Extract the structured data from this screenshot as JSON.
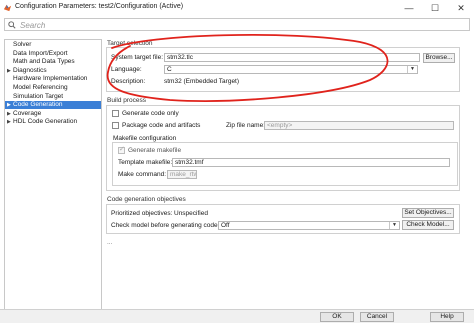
{
  "window": {
    "title": "Configuration Parameters: test2/Configuration (Active)",
    "minimize_label": "—",
    "maximize_label": "☐",
    "close_label": "✕"
  },
  "search": {
    "placeholder": "Search"
  },
  "sidebar": {
    "items": [
      {
        "label": "Solver",
        "arrow": ""
      },
      {
        "label": "Data Import/Export",
        "arrow": ""
      },
      {
        "label": "Math and Data Types",
        "arrow": ""
      },
      {
        "label": "Diagnostics",
        "arrow": "▶"
      },
      {
        "label": "Hardware Implementation",
        "arrow": ""
      },
      {
        "label": "Model Referencing",
        "arrow": ""
      },
      {
        "label": "Simulation Target",
        "arrow": ""
      },
      {
        "label": "Code Generation",
        "arrow": "▶",
        "selected": true
      },
      {
        "label": "Coverage",
        "arrow": "▶"
      },
      {
        "label": "HDL Code Generation",
        "arrow": "▶"
      }
    ]
  },
  "target": {
    "section_title": "Target selection",
    "system_target_label": "System target file:",
    "system_target_value": "stm32.tlc",
    "browse_label": "Browse...",
    "language_label": "Language:",
    "language_value": "C",
    "description_label": "Description:",
    "description_value": "stm32 (Embedded Target)"
  },
  "build": {
    "section_title": "Build process",
    "generate_only_label": "Generate code only",
    "package_label": "Package code and artifacts",
    "zip_label": "Zip file name:",
    "zip_placeholder": "<empty>",
    "makefile_section": "Makefile configuration",
    "generate_makefile_label": "Generate makefile",
    "template_label": "Template makefile:",
    "template_value": "stm32.tmf",
    "make_command_label": "Make command:",
    "make_command_value": "make_rtw"
  },
  "objectives": {
    "section_title": "Code generation objectives",
    "prioritized_label": "Prioritized objectives:",
    "prioritized_value": "Unspecified",
    "set_objectives_label": "Set Objectives...",
    "check_label": "Check model before generating code:",
    "check_value": "Off",
    "check_model_label": "Check Model...",
    "ellipsis": "..."
  },
  "footer": {
    "ok_label": "OK",
    "cancel_label": "Cancel",
    "help_label": "Help"
  },
  "colors": {
    "selection": "#3b7fd6",
    "annotation": "#e0231c"
  }
}
